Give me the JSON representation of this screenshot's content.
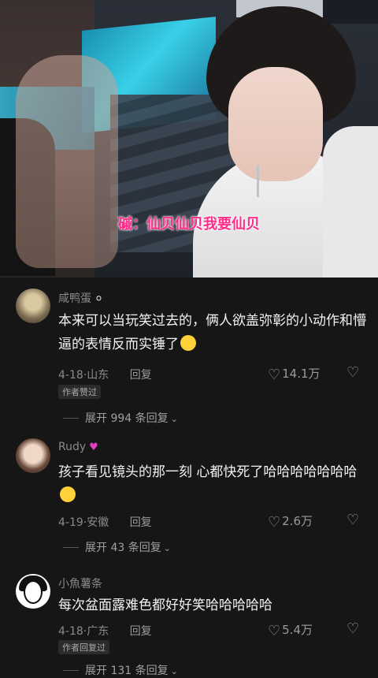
{
  "video": {
    "subtitle": "磩：仙贝仙贝我要仙贝"
  },
  "comments": [
    {
      "username": "咸鸭蛋",
      "badge_icon": "egg-icon",
      "text": "本来可以当玩笑过去的，俩人欲盖弥彰的小动作和懵逼的表情反而实锤了",
      "emoji": "crying-face-emoji",
      "date": "4-18",
      "location": "山东",
      "reply_label": "回复",
      "likes": "14.1万",
      "tag": "作者赞过",
      "expand_label": "展开 994 条回复"
    },
    {
      "username": "Rudy",
      "badge_icon": "heart-icon",
      "text": "孩子看见镜头的那一刻 心都快死了哈哈哈哈哈哈哈",
      "emoji": "smiling-face-emoji",
      "date": "4-19",
      "location": "安徽",
      "reply_label": "回复",
      "likes": "2.6万",
      "expand_label": "展开 43 条回复"
    },
    {
      "username": "小魚薯条",
      "text": "每次盆面露难色都好好笑哈哈哈哈哈",
      "date": "4-18",
      "location": "广东",
      "reply_label": "回复",
      "likes": "5.4万",
      "tag": "作者回复过",
      "expand_label": "展开 131 条回复"
    }
  ],
  "colors": {
    "background": "#161616",
    "subtitle": "#ff2d8a",
    "muted_text": "#8a8a8a"
  }
}
